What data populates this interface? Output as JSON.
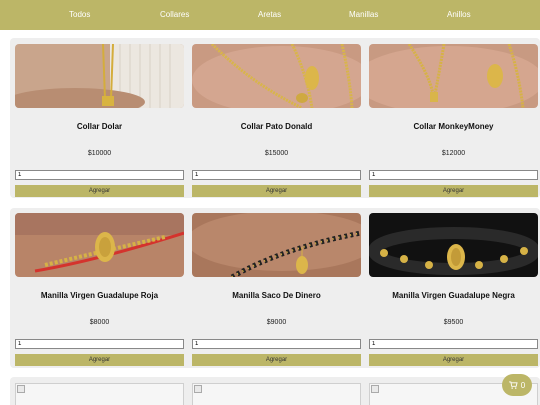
{
  "nav": {
    "items": [
      "Todos",
      "Collares",
      "Aretas",
      "Manillas",
      "Anillos"
    ]
  },
  "products": [
    {
      "name": "Collar Dolar",
      "price": "$10000",
      "qty": "1",
      "button": "Agregar"
    },
    {
      "name": "Collar Pato Donald",
      "price": "$15000",
      "qty": "1",
      "button": "Agregar"
    },
    {
      "name": "Collar MonkeyMoney",
      "price": "$12000",
      "qty": "1",
      "button": "Agregar"
    },
    {
      "name": "Manilla Virgen Guadalupe Roja",
      "price": "$8000",
      "qty": "1",
      "button": "Agregar"
    },
    {
      "name": "Manilla Saco De Dinero",
      "price": "$9000",
      "qty": "1",
      "button": "Agregar"
    },
    {
      "name": "Manilla Virgen Guadalupe Negra",
      "price": "$9500",
      "qty": "1",
      "button": "Agregar"
    }
  ],
  "cart": {
    "count": "0",
    "icon": "cart-icon"
  },
  "colors": {
    "accent": "#bcb667",
    "card_bg": "#eeeeee"
  }
}
